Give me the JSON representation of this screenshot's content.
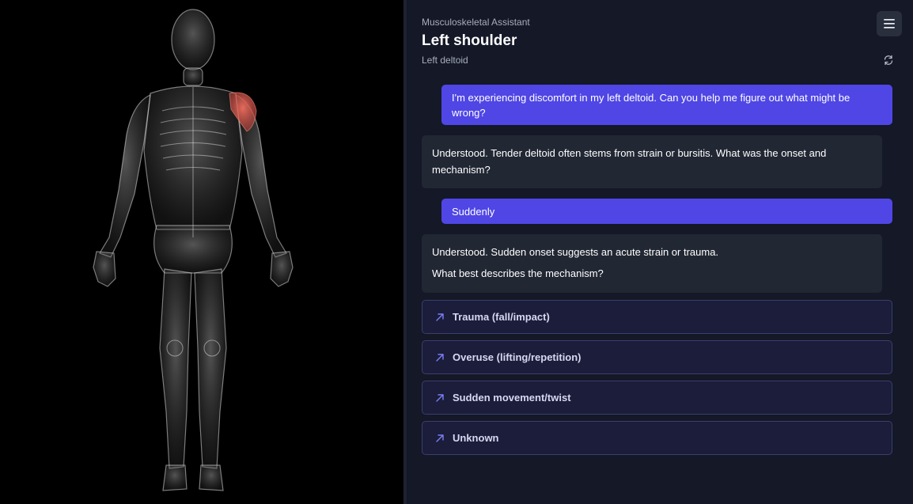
{
  "header": {
    "app_name": "Musculoskeletal Assistant",
    "title": "Left shoulder",
    "subtitle": "Left deltoid"
  },
  "icons": {
    "menu": "hamburger-menu-icon",
    "refresh": "refresh-icon",
    "option": "arrow-up-right-icon"
  },
  "viewer": {
    "highlighted_region": "left deltoid",
    "highlight_color": "#e0574a"
  },
  "colors": {
    "user_bubble": "#4f46e5",
    "bot_bubble": "#212733",
    "option_border": "#3a3f6e",
    "accent_icon": "#7c7ff5"
  },
  "conversation": [
    {
      "role": "user",
      "text": "I'm experiencing discomfort in my left deltoid. Can you help me figure out what might be wrong?"
    },
    {
      "role": "assistant",
      "lines": [
        "Understood. Tender deltoid often stems from strain or bursitis. What was the onset and mechanism?"
      ]
    },
    {
      "role": "user",
      "text": "Suddenly"
    },
    {
      "role": "assistant",
      "lines": [
        "Understood. Sudden onset suggests an acute strain or trauma.",
        "What best describes the mechanism?"
      ]
    }
  ],
  "options": [
    {
      "label": "Trauma (fall/impact)"
    },
    {
      "label": "Overuse (lifting/repetition)"
    },
    {
      "label": "Sudden movement/twist"
    },
    {
      "label": "Unknown"
    }
  ]
}
